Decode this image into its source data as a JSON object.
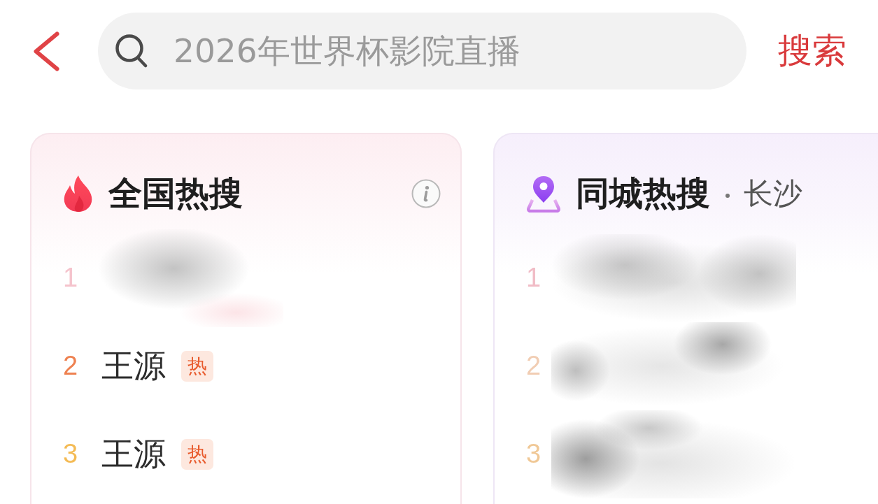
{
  "top_bar": {
    "search": {
      "placeholder": "2026年世界杯影院直播"
    },
    "search_button": "搜索"
  },
  "cards": [
    {
      "kind": "national",
      "title": "全国热搜",
      "info": true,
      "items": [
        {
          "rank": "1",
          "blurred": true,
          "color": "#f5c3cc"
        },
        {
          "rank": "2",
          "title": "王源",
          "badge": "热",
          "blurred": false,
          "color": "#ee8150"
        },
        {
          "rank": "3",
          "title": "王源",
          "badge": "热",
          "blurred": false,
          "color": "#f4bb55"
        }
      ]
    },
    {
      "kind": "local",
      "title": "同城热搜",
      "city": "长沙",
      "items": [
        {
          "rank": "1",
          "blurred": true,
          "color": "#f1bcc6"
        },
        {
          "rank": "2",
          "blurred": true,
          "color": "#f1cdb3"
        },
        {
          "rank": "3",
          "blurred": true,
          "color": "#f0c896"
        }
      ]
    }
  ]
}
